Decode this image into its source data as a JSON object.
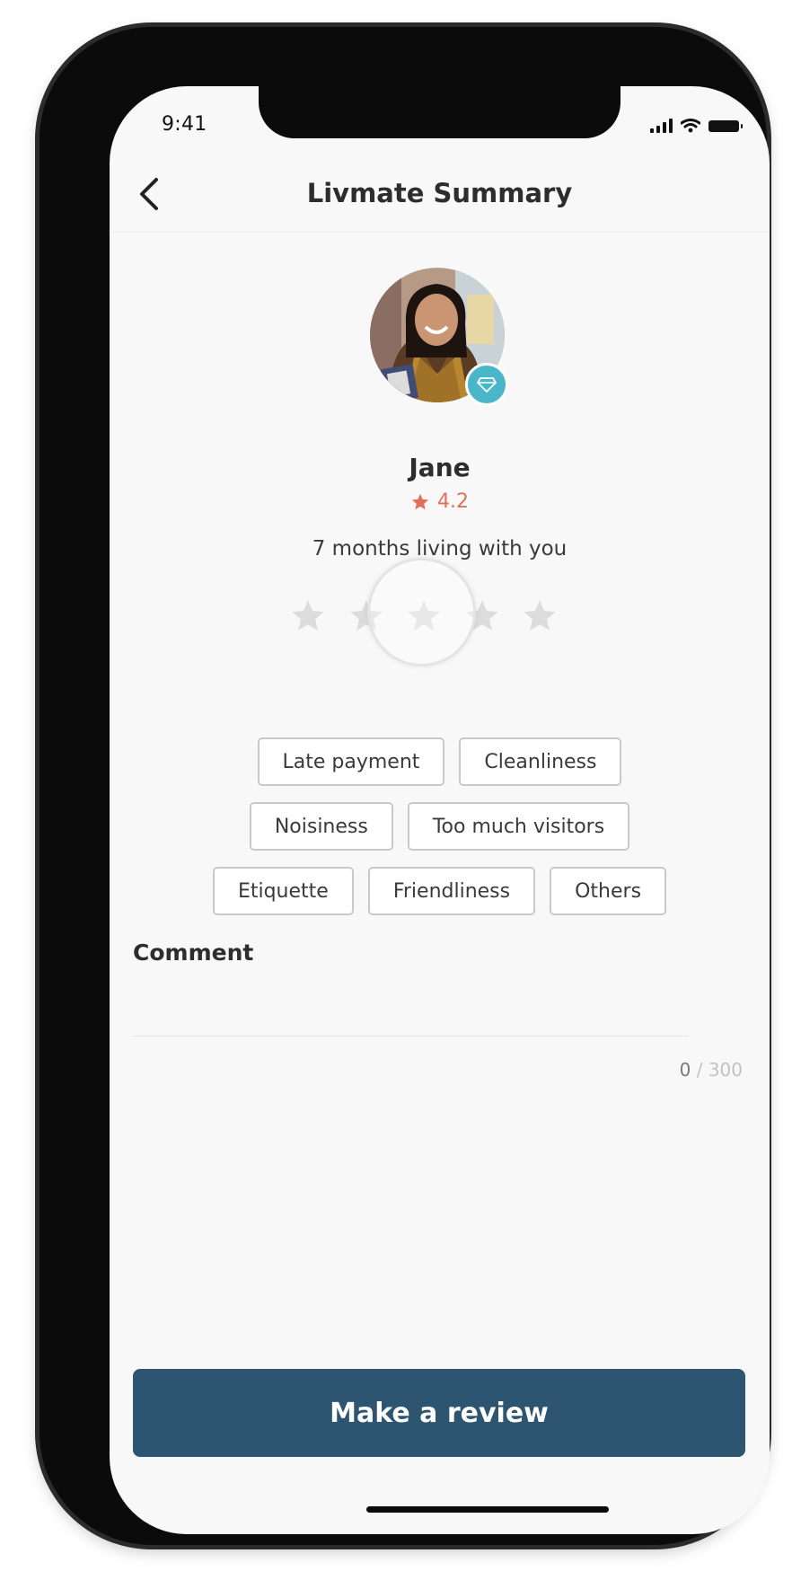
{
  "status_bar": {
    "time": "9:41"
  },
  "header": {
    "title": "Livmate Summary",
    "back_icon": "chevron-left-icon"
  },
  "profile": {
    "name": "Jane",
    "rating": "4.2",
    "duration": "7 months living with you",
    "badge_icon": "diamond-icon"
  },
  "review": {
    "stars_total": 5,
    "stars_selected": 0
  },
  "chips": [
    [
      "Late payment",
      "Cleanliness"
    ],
    [
      "Noisiness",
      "Too much visitors"
    ],
    [
      "Etiquette",
      "Friendliness",
      "Others"
    ]
  ],
  "comment": {
    "label": "Comment",
    "value": "",
    "count": "0",
    "max": "/ 300"
  },
  "cta": {
    "label": "Make a review"
  },
  "colors": {
    "accent": "#2d5470",
    "rating": "#e07058",
    "badge": "#49b6c9"
  }
}
